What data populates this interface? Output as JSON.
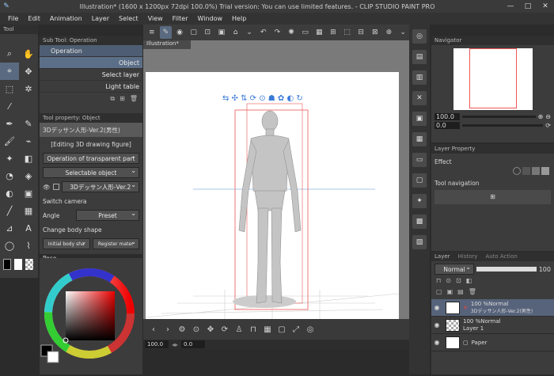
{
  "app": {
    "title": "Illustration* (1600 x 1200px 72dpi 100.0%)  Trial version: You can use limited features. - CLIP STUDIO PAINT PRO"
  },
  "menu": [
    "File",
    "Edit",
    "Animation",
    "Layer",
    "Select",
    "View",
    "Filter",
    "Window",
    "Help"
  ],
  "canvas_tab": "Illustration*",
  "subtool": {
    "tab": "Sub Tool: Operation",
    "group": "Operation",
    "items": [
      "Object",
      "Select layer",
      "Light table"
    ]
  },
  "tool_property": {
    "tab": "Tool property: Object",
    "model_name": "3Dデッサン人形-Ver.2(男性)",
    "editing": "[Editing 3D drawing figure]",
    "operation_mode": "Operation of transparent part",
    "selectable": "Selectable object",
    "layer_model": "3Dデッサン人形-Ver.2",
    "switch_camera": "Switch camera",
    "angle_label": "Angle",
    "angle_value": "Preset",
    "change_body": "Change body shape",
    "initial_body": "Initial body sha",
    "register_material": "Register mater",
    "pose": "Pose"
  },
  "navigator": {
    "tab": "Navigator",
    "zoom": "100.0",
    "angle": "0.0"
  },
  "layer_property": {
    "tab": "Layer Property",
    "effect": "Effect",
    "tool_navigation": "Tool navigation"
  },
  "layer_panel": {
    "tabs": [
      "Layer",
      "History",
      "Auto Action"
    ],
    "blend": "Normal",
    "opacity": "100",
    "layers": [
      {
        "top": "100 %Normal",
        "name": "3Dデッサン人形-Ver.2(男性)"
      },
      {
        "top": "100 %Normal",
        "name": "Layer 1"
      },
      {
        "top": "",
        "name": "Paper"
      }
    ]
  },
  "status": {
    "zoom": "100.0",
    "angle": "0.0"
  },
  "colors": {
    "accent": "#5c6f88",
    "panel": "#3c3c3c"
  }
}
